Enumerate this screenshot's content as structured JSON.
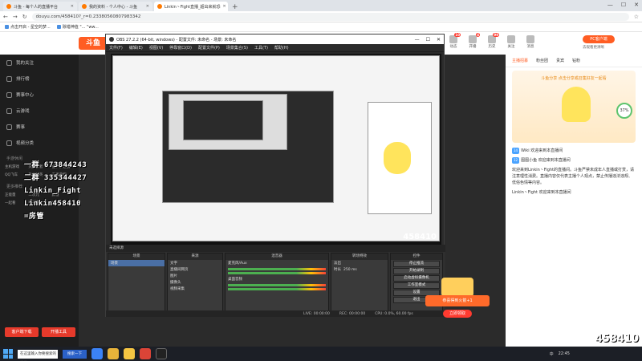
{
  "browser": {
    "tabs": [
      {
        "label": "斗鱼 - 每个人的直播平台",
        "active": false
      },
      {
        "label": "我的资料 - 个人中心 - 斗鱼",
        "active": false
      },
      {
        "label": "Linkin丶Fight直播_超出来就恐",
        "active": true
      }
    ],
    "url": "douyu.com/458410?_r=0.23380560807983342",
    "bookmarks": [
      "点击开启 - 星空的梦...",
      "除错神值 \"... \"ww..."
    ]
  },
  "douyu": {
    "logo": "斗鱼",
    "header_icons": [
      {
        "label": "动态",
        "badge": "10"
      },
      {
        "label": "开播",
        "badge": "4"
      },
      {
        "label": "历史",
        "badge": "99"
      },
      {
        "label": "关注",
        "badge": ""
      },
      {
        "label": "消息",
        "badge": ""
      }
    ],
    "pc_client": "PC客户端",
    "pc_client_sub": "去观看更清晰",
    "sidebar": {
      "items": [
        "我的关注",
        "排行榜",
        "赛事中心",
        "云游戏",
        "赛事",
        "视频分类"
      ],
      "section_game": "手游休闲",
      "games": [
        "主机游戏",
        "火影忍者",
        "金铲铲之战",
        "QQ飞车",
        "和平精英",
        "王者荣耀"
      ],
      "section_more": "更多推荐",
      "more": [
        "正能量",
        "二次元",
        "颜值",
        "一起看",
        "DOTA",
        "QQ飞车"
      ],
      "btn_left": "客户端下载",
      "btn_right": "开播工具"
    },
    "stream_overlay_lines": [
      "一群 673844243",
      "二群 335344427",
      "Linkin_Fight",
      "Linkin458410",
      "=房管"
    ],
    "right_panel": {
      "tabs": [
        "主播招募",
        "粉丝团",
        "贵宾",
        "钻粉"
      ],
      "promo_title": "斗鱼分享 点击分享或召集好友一起看",
      "percent": "37%",
      "chat": [
        {
          "level": "14",
          "name": "Wiki",
          "text": "欢迎来到本直播间"
        },
        {
          "level": "12",
          "name": "图图小鱼",
          "text": "欢迎来到本直播间"
        },
        {
          "level": "",
          "name": "",
          "text": "欢迎来到Linkin丶Fight的直播间。斗鱼严禁未成年人直播或打赏，请注意理性消费。直播内容仅代表主播个人观点，禁止传播违法违规、低俗色情等内容。"
        },
        {
          "level": "",
          "name": "Linkin丶Fight",
          "text": "欢迎来到本直播间"
        }
      ]
    },
    "watermark": "斗鱼",
    "room_no": "458410"
  },
  "obs": {
    "title": "OBS 27.2.2 (64-bit, windows) - 配置文件: 未命名 - 场景: 未命名",
    "menu": [
      "文件(F)",
      "编辑(E)",
      "视图(V)",
      "停靠窗口(D)",
      "配置文件(P)",
      "场景集合(S)",
      "工具(T)",
      "帮助(H)"
    ],
    "dock_header": "未选择源",
    "docks": {
      "scenes": {
        "title": "场景",
        "items": [
          "场景"
        ]
      },
      "sources": {
        "title": "来源",
        "items": [
          "文字",
          "直播间网页",
          "图片",
          "摄像头",
          "视频采集"
        ]
      },
      "mixer": {
        "title": "混音器",
        "items": [
          "麦克风/Aux",
          "桌面音频"
        ]
      },
      "transitions": {
        "title": "转场特效",
        "type": "淡出",
        "duration_label": "时长",
        "duration": "250 ms"
      },
      "controls": {
        "title": "控件",
        "buttons": [
          "停止推流",
          "开始录制",
          "启动虚拟摄像机",
          "工作室模式",
          "设置",
          "退出"
        ]
      }
    },
    "status": [
      "LIVE: 00:00:00",
      "REC: 00:00:00",
      "CPU: 0.0%, 60.00 fps"
    ]
  },
  "gift_popup": {
    "banner": "恭喜得到火箭+1",
    "button": "立即领取"
  },
  "taskbar": {
    "search": "在这里输入你要搜索的内容",
    "button": "搜索一下",
    "tray": [
      "中",
      "22:45"
    ]
  }
}
